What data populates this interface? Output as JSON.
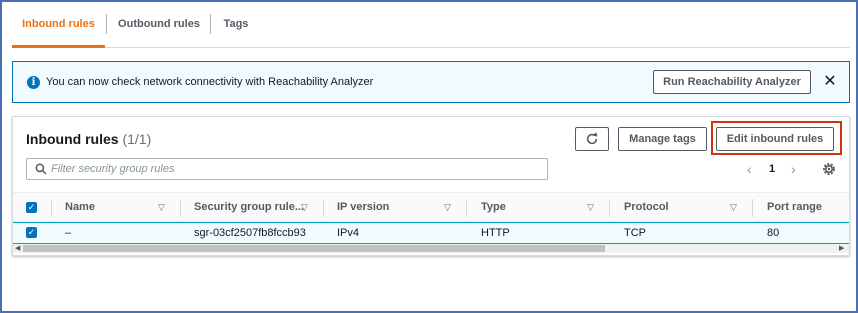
{
  "tabs": [
    {
      "label": "Inbound rules",
      "active": true
    },
    {
      "label": "Outbound rules",
      "active": false
    },
    {
      "label": "Tags",
      "active": false
    }
  ],
  "banner": {
    "text": "You can now check network connectivity with Reachability Analyzer",
    "button_label": "Run Reachability Analyzer",
    "info_icon": "i",
    "close_icon": "✕"
  },
  "panel": {
    "title": "Inbound rules",
    "count": "(1/1)",
    "refresh_icon": "refresh-icon",
    "manage_tags_label": "Manage tags",
    "edit_rules_label": "Edit inbound rules"
  },
  "search": {
    "placeholder": "Filter security group rules"
  },
  "pagination": {
    "prev": "‹",
    "page": "1",
    "next": "›"
  },
  "table": {
    "columns": [
      "Name",
      "Security group rule...",
      "IP version",
      "Type",
      "Protocol",
      "Port range"
    ],
    "rows": [
      {
        "selected": true,
        "name": "–",
        "rule_id": "sgr-03cf2507fb8fccb93",
        "ip_version": "IPv4",
        "type": "HTTP",
        "protocol": "TCP",
        "port_range": "80"
      }
    ]
  },
  "colors": {
    "accent": "#ec7211",
    "info_blue": "#0073bb",
    "highlight_red": "#d13212"
  }
}
